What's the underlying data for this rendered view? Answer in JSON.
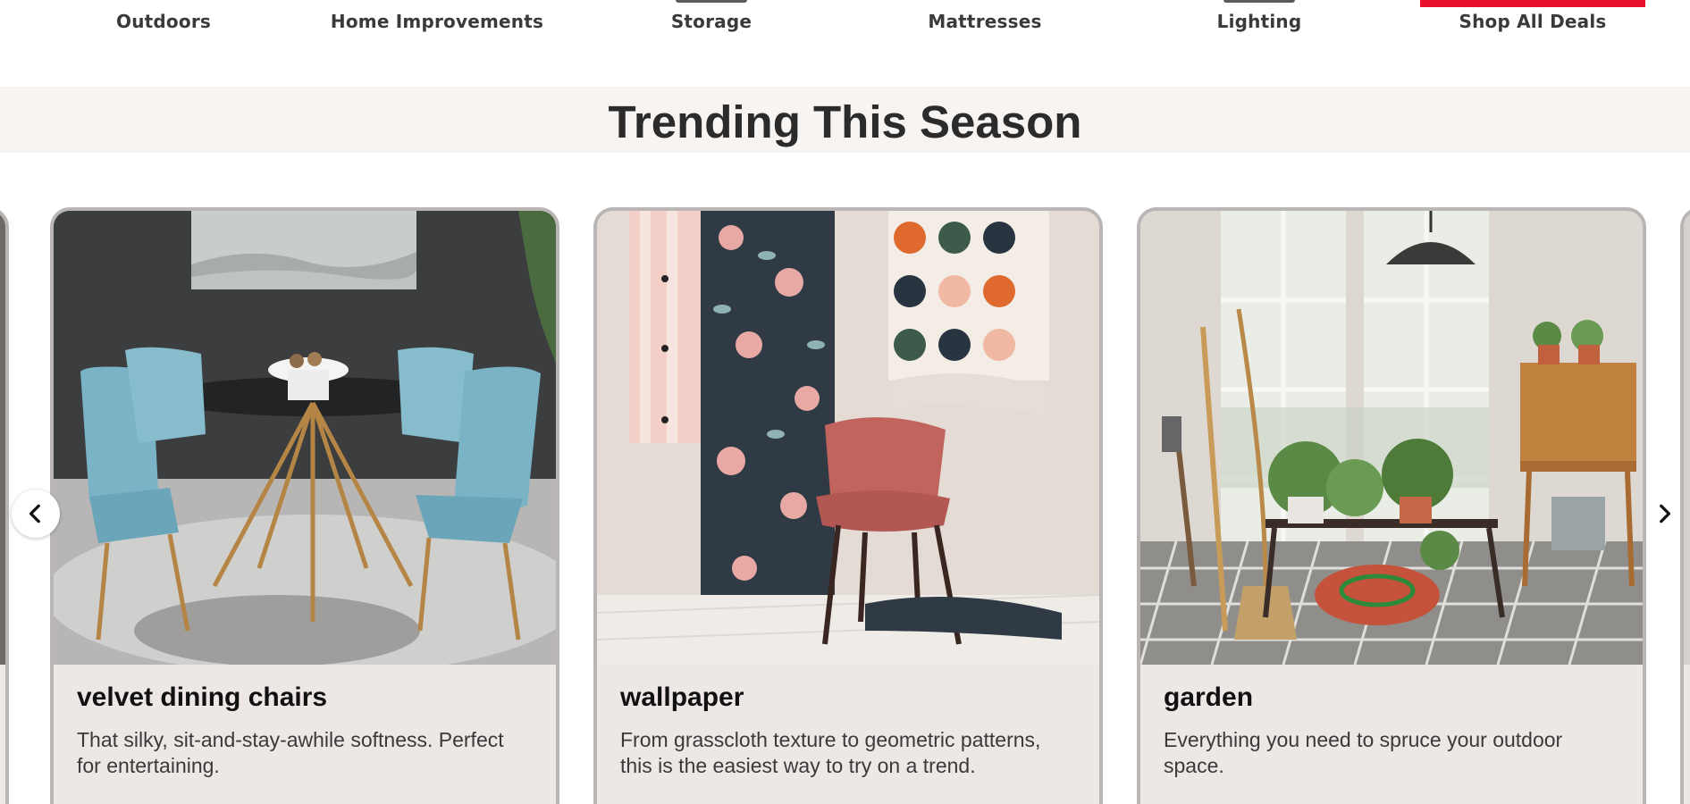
{
  "category_nav": {
    "items": [
      {
        "label": "Outdoors"
      },
      {
        "label": "Home Improvements"
      },
      {
        "label": "Storage"
      },
      {
        "label": "Mattresses"
      },
      {
        "label": "Lighting"
      },
      {
        "label": "Shop All Deals"
      }
    ],
    "accent_color": "#e8112d"
  },
  "section": {
    "title": "Trending This Season"
  },
  "carousel": {
    "prev_icon": "chevron-left-icon",
    "next_icon": "chevron-right-icon",
    "cards": [
      {
        "title": "velvet dining chairs",
        "description": "That silky, sit-and-stay-awhile softness. Perfect for entertaining.",
        "image": "dining-room-photo"
      },
      {
        "title": "wallpaper",
        "description": "From grasscloth texture to geometric patterns, this is the easiest way to try on a trend.",
        "image": "wallpaper-photo"
      },
      {
        "title": "garden",
        "description": "Everything you need to spruce your outdoor space.",
        "image": "garden-photo"
      }
    ]
  }
}
